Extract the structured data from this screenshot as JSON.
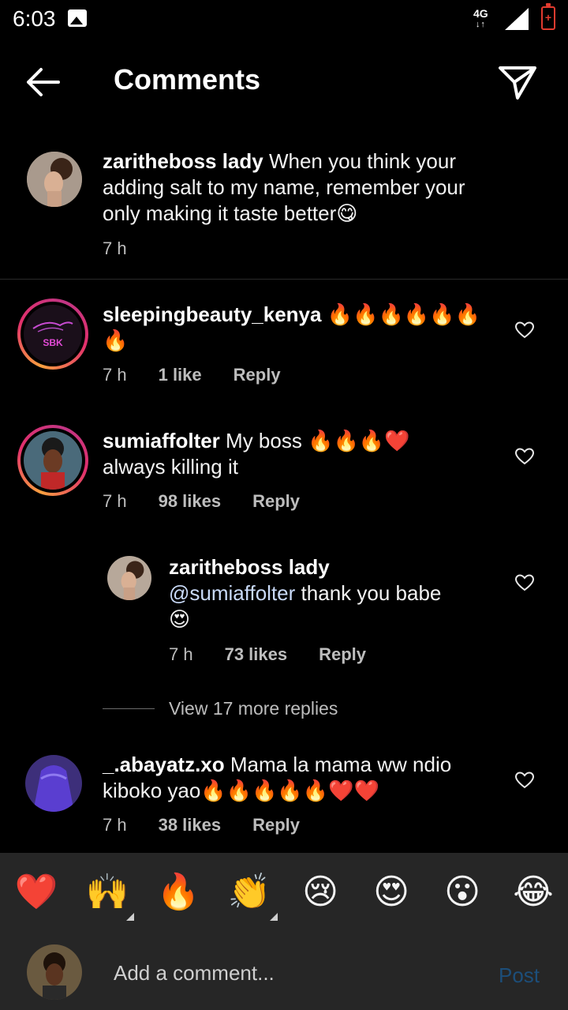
{
  "status_bar": {
    "time": "6:03",
    "network": "4G",
    "net_arrows": "↓↑",
    "battery_glyph": "+",
    "battery_color": "#e23b2f"
  },
  "header": {
    "title": "Comments"
  },
  "caption": {
    "username": "zaritheboss lady",
    "text_line1": "When you think your",
    "text_line2": "adding salt to my name, remember your",
    "text_line3": "only making it taste better😋",
    "time": "7 h"
  },
  "comments": [
    {
      "username": "sleepingbeauty_kenya",
      "text_line1": "🔥🔥🔥🔥🔥🔥",
      "text_line2": "🔥",
      "avatar_label": "SBK",
      "time": "7 h",
      "likes": "1 like",
      "reply": "Reply"
    },
    {
      "username": "sumiaffolter",
      "text_line1": "My boss 🔥🔥🔥❤️",
      "text_line2": "always killing it",
      "time": "7 h",
      "likes": "98 likes",
      "reply": "Reply"
    },
    {
      "username": "zaritheboss lady",
      "mention": "@sumiaffolter",
      "text_line1": "thank you babe",
      "text_line2": "😍",
      "time": "7 h",
      "likes": "73 likes",
      "reply": "Reply"
    },
    {
      "username": "_.abayatz.xo",
      "text_line1": "Mama la mama ww ndio",
      "text_line2": "kiboko yao🔥🔥🔥🔥🔥❤️❤️",
      "time": "7 h",
      "likes": "38 likes",
      "reply": "Reply"
    }
  ],
  "view_more": "View 17 more replies",
  "emoji_bar": [
    "❤️",
    "🙌",
    "🔥",
    "👏",
    "😢",
    "😍",
    "😮",
    "😂"
  ],
  "composer": {
    "placeholder": "Add a comment...",
    "post_label": "Post",
    "post_color": "#1c4e7a"
  },
  "accent": {
    "ring_gradient": [
      "#f9a03f",
      "#e1306c",
      "#c13584"
    ],
    "text": "#f2f2f2",
    "muted": "#bdbdbd"
  }
}
